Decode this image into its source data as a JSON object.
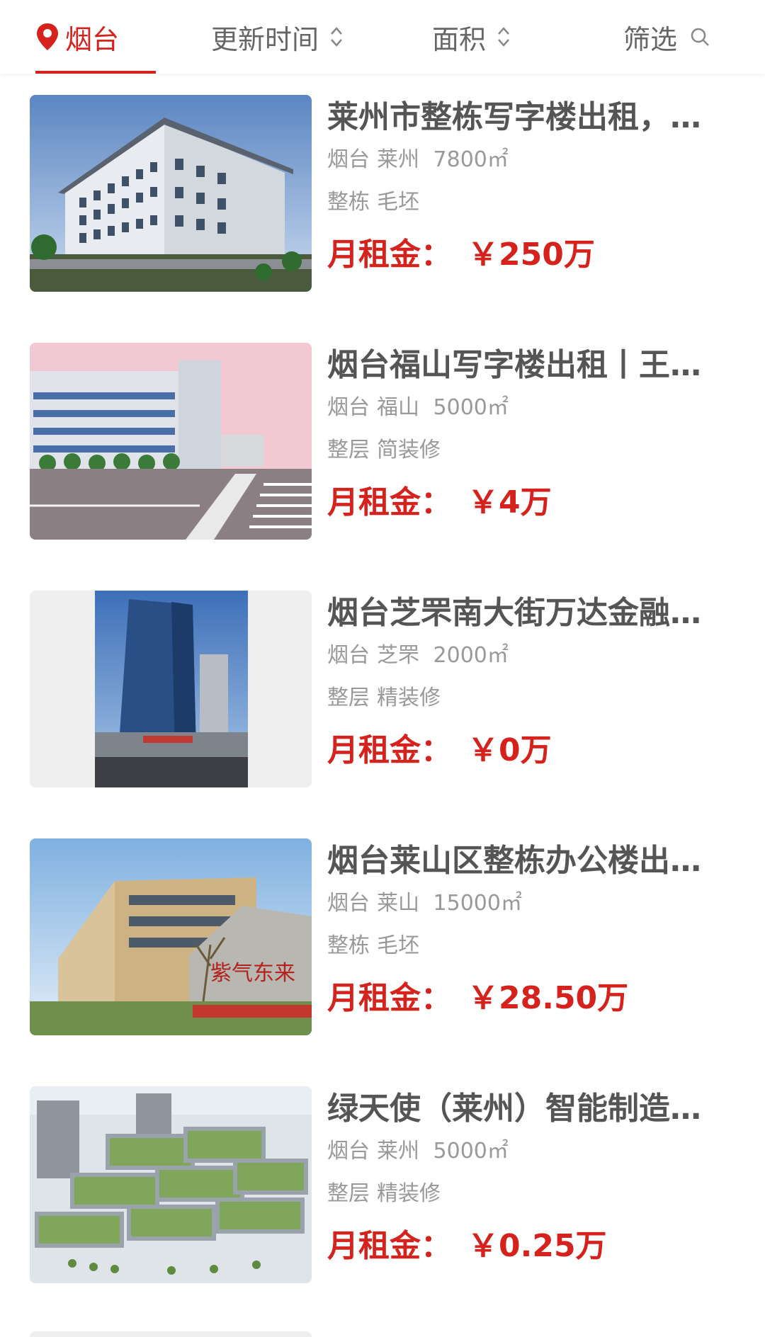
{
  "topbar": {
    "city": "烟台",
    "update_time": "更新时间",
    "area": "面积",
    "filter": "筛选"
  },
  "colors": {
    "accent": "#d6221c",
    "muted": "#999999"
  },
  "listings": [
    {
      "title": "莱州市整栋写字楼出租，…",
      "city": "烟台",
      "district": "莱州",
      "size": "7800㎡",
      "floor_type": "整栋",
      "decoration": "毛坯",
      "price_label": "月租金：",
      "price": "￥250万"
    },
    {
      "title": "烟台福山写字楼出租丨王…",
      "city": "烟台",
      "district": "福山",
      "size": "5000㎡",
      "floor_type": "整层",
      "decoration": "简装修",
      "price_label": "月租金：",
      "price": "￥4万"
    },
    {
      "title": "烟台芝罘南大街万达金融…",
      "city": "烟台",
      "district": "芝罘",
      "size": "2000㎡",
      "floor_type": "整层",
      "decoration": "精装修",
      "price_label": "月租金：",
      "price": "￥0万"
    },
    {
      "title": "烟台莱山区整栋办公楼出…",
      "city": "烟台",
      "district": "莱山",
      "size": "15000㎡",
      "floor_type": "整栋",
      "decoration": "毛坯",
      "price_label": "月租金：",
      "price": "￥28.50万"
    },
    {
      "title": "绿天使（莱州）智能制造…",
      "city": "烟台",
      "district": "莱州",
      "size": "5000㎡",
      "floor_type": "整层",
      "decoration": "精装修",
      "price_label": "月租金：",
      "price": "￥0.25万"
    }
  ],
  "thumbnail_images": [
    "office-building-photo",
    "factory-building-photo",
    "glass-tower-photo",
    "office-building-with-stone-photo",
    "industrial-park-render"
  ],
  "stone_text": "紫气东来"
}
